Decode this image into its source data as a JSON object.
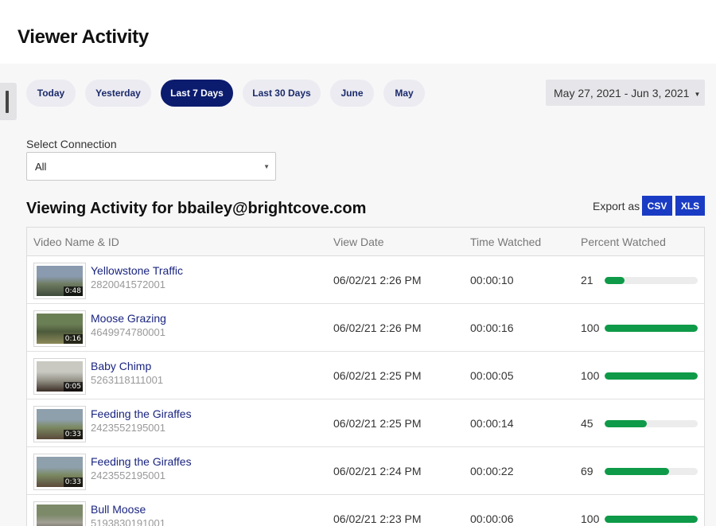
{
  "page": {
    "title": "Viewer Activity"
  },
  "range_buttons": [
    {
      "label": "Today",
      "active": false
    },
    {
      "label": "Yesterday",
      "active": false
    },
    {
      "label": "Last 7 Days",
      "active": true
    },
    {
      "label": "Last 30 Days",
      "active": false
    },
    {
      "label": "June",
      "active": false
    },
    {
      "label": "May",
      "active": false
    }
  ],
  "date_range": {
    "label": "May 27, 2021 - Jun 3, 2021",
    "caret_icon": "caret-down-icon"
  },
  "connection": {
    "label": "Select Connection",
    "value": "All"
  },
  "section": {
    "title": "Viewing Activity for bbailey@brightcove.com"
  },
  "export": {
    "label": "Export as",
    "csv": "CSV",
    "xls": "XLS"
  },
  "colors": {
    "brand_navy": "#0b1b6e",
    "export_blue": "#1a3cc4",
    "progress_green": "#0e9a48",
    "link_navy": "#1a2580"
  },
  "table": {
    "headers": {
      "video": "Video Name & ID",
      "date": "View Date",
      "time": "Time Watched",
      "percent": "Percent Watched"
    },
    "rows": [
      {
        "name": "Yellowstone Traffic",
        "id": "2820041572001",
        "duration": "0:48",
        "date": "06/02/21 2:26 PM",
        "time": "00:00:10",
        "percent": 21,
        "thumb_colors": [
          "#8a9bb0",
          "#3e4a3a",
          "#6f7c62"
        ]
      },
      {
        "name": "Moose Grazing",
        "id": "4649974780001",
        "duration": "0:16",
        "date": "06/02/21 2:26 PM",
        "time": "00:00:16",
        "percent": 100,
        "thumb_colors": [
          "#6b7f55",
          "#8c8a5a",
          "#4d5a3b"
        ]
      },
      {
        "name": "Baby Chimp",
        "id": "5263118111001",
        "duration": "0:05",
        "date": "06/02/21 2:25 PM",
        "time": "00:00:05",
        "percent": 100,
        "thumb_colors": [
          "#c9c9c2",
          "#3a2e26",
          "#9c9a8f"
        ]
      },
      {
        "name": "Feeding the Giraffes",
        "id": "2423552195001",
        "duration": "0:33",
        "date": "06/02/21 2:25 PM",
        "time": "00:00:14",
        "percent": 45,
        "thumb_colors": [
          "#8fa0ad",
          "#5a4a3a",
          "#7b8a63"
        ]
      },
      {
        "name": "Feeding the Giraffes",
        "id": "2423552195001",
        "duration": "0:33",
        "date": "06/02/21 2:24 PM",
        "time": "00:00:22",
        "percent": 69,
        "thumb_colors": [
          "#8fa0ad",
          "#5a4a3a",
          "#7b8a63"
        ]
      },
      {
        "name": "Bull Moose",
        "id": "5193830191001",
        "duration": "",
        "date": "06/02/21 2:23 PM",
        "time": "00:00:06",
        "percent": 100,
        "thumb_colors": [
          "#7d8a6a",
          "#3a3330",
          "#a29f95"
        ]
      }
    ]
  }
}
